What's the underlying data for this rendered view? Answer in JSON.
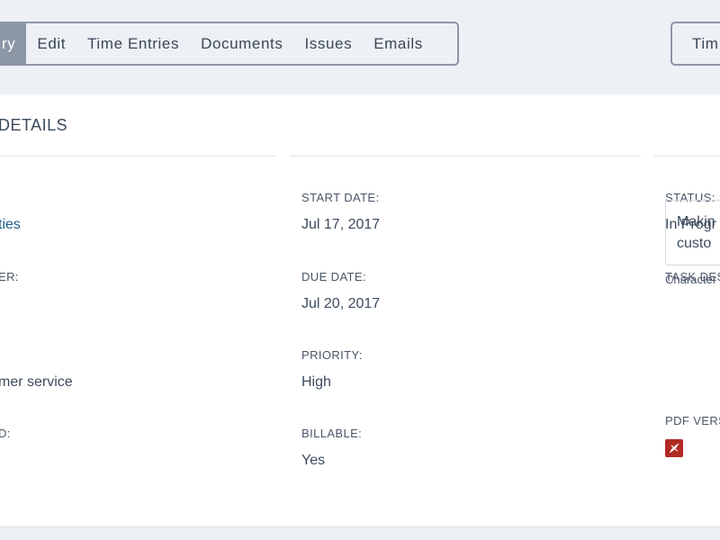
{
  "tabs": [
    {
      "label": "ry",
      "active": true
    },
    {
      "label": "Edit",
      "active": false
    },
    {
      "label": "Time Entries",
      "active": false
    },
    {
      "label": "Documents",
      "active": false
    },
    {
      "label": "Issues",
      "active": false
    },
    {
      "label": "Emails",
      "active": false
    }
  ],
  "right_button": {
    "label": "Tim"
  },
  "card": {
    "title": "DETAILS",
    "left_column": {
      "value1": "ties",
      "label2": "ER:",
      "value3": "mer service",
      "label4": "D:"
    },
    "middle_column": {
      "start_date_label": "START DATE:",
      "start_date_value": "Jul 17, 2017",
      "due_date_label": "DUE DATE:",
      "due_date_value": "Jul 20, 2017",
      "priority_label": "PRIORITY:",
      "priority_value": "High",
      "billable_label": "BILLABLE:",
      "billable_value": "Yes"
    },
    "right_column": {
      "status_label": "STATUS:",
      "status_value": "In Progr",
      "task_desc_label": "TASK DES",
      "task_desc_line1": "Makin",
      "task_desc_line2": "custo",
      "char_note": "Character",
      "pdf_label": "PDF VERS"
    }
  },
  "colors": {
    "accent_tab_bg": "#8c97a6",
    "link": "#1d5f8a",
    "pdf_icon": "#b02a22",
    "page_bg": "#edf0f4"
  },
  "icons": {
    "pdf": "pdf-file-icon"
  }
}
